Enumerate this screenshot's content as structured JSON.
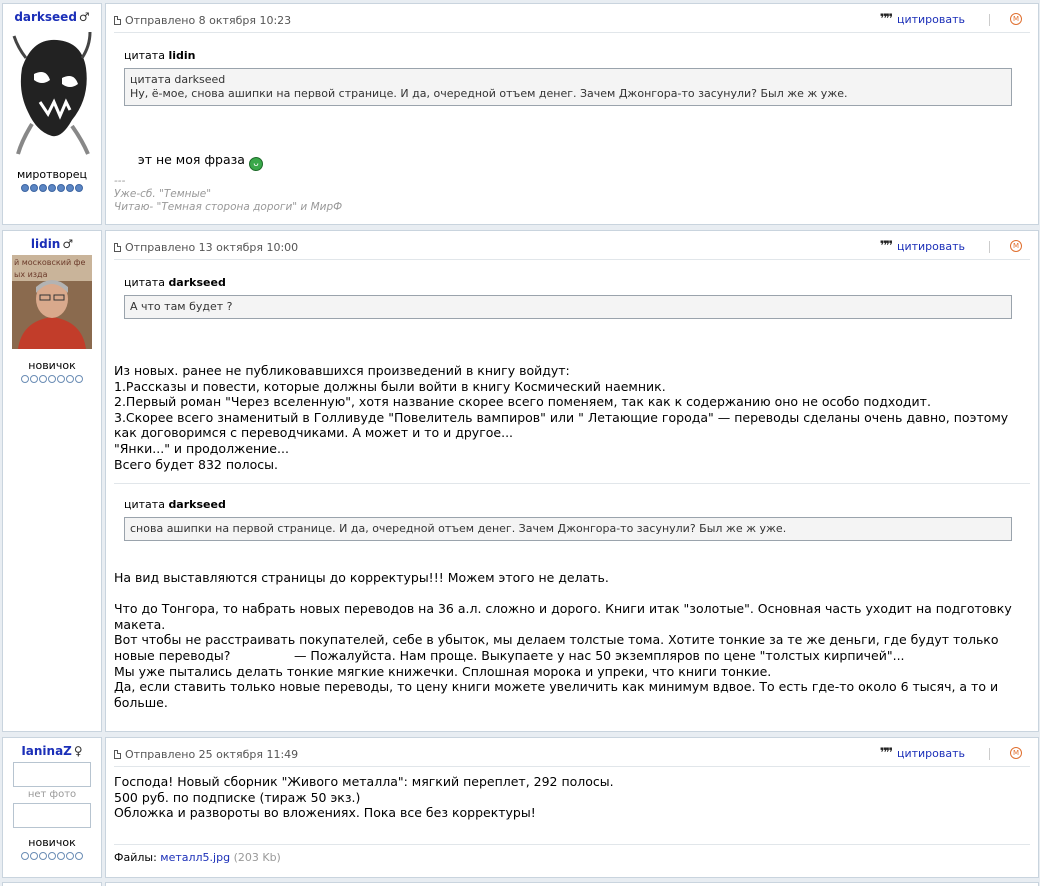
{
  "posts": [
    {
      "author": "darkseed",
      "gender_icon": "♂",
      "avatar": "dark-creature-avatar",
      "rank": "миротворец",
      "rank_level": 7,
      "posted": "Отправлено 8 октября 10:23",
      "quote_label": "цитировать",
      "outer_quote": {
        "prefix": "цитата",
        "author": "lidin"
      },
      "inner_quote": {
        "prefix": "цитата darkseed",
        "text": "Ну, ё-мое, снова ашипки на первой странице. И да, очередной отъем денег. Зачем Джонгора-то засунули? Был же ж уже."
      },
      "text": "эт не моя фраза",
      "smiley": "smiley-icon",
      "signature": "---\nУже-сб. \"Темные\"\nЧитаю- \"Темная сторона дороги\" и МирФ"
    },
    {
      "author": "lidin",
      "gender_icon": "♂",
      "avatar": "photo-avatar",
      "rank": "новичок",
      "rank_level": 0,
      "posted": "Отправлено 13 октября 10:00",
      "quote_label": "цитировать",
      "quote1": {
        "prefix": "цитата",
        "author": "darkseed",
        "text": "А что там будет ?"
      },
      "text1": "Из новых. ранее не публиковавшихся произведений в книгу войдут:\n1.Рассказы и повести, которые должны были войти в книгу Космический наемник.\n2.Первый роман \"Через вселенную\", хотя название скорее всего поменяем, так как к содержанию оно не особо подходит.\n3.Скорее всего знаменитый в Голливуде \"Повелитель вампиров\" или \" Летающие города\" — переводы сделаны очень давно, поэтому как договоримся с переводчиками. А может и то и другое...\n\"Янки...\" и продолжение...\nВсего будет 832 полосы.",
      "quote2": {
        "prefix": "цитата",
        "author": "darkseed",
        "text": "снова ашипки на первой странице. И да, очередной отъем денег. Зачем Джонгора-то засунули? Был же ж уже."
      },
      "text2": "На вид выставляются страницы до корректуры!!! Можем этого не делать.\n\nЧто до Тонгора, то набрать новых переводов на 36 а.л. сложно и дорого. Книги итак \"золотые\". Основная часть уходит на подготовку макета.\nВот чтобы не расстраивать покупателей, себе в убыток, мы делаем толстые тома. Хотите тонкие за те же деньги, где будут только новые переводы?                — Пожалуйста. Нам проще. Выкупаете у нас 50 экземпляров по цене \"толстых кирпичей\"...\nМы уже пытались делать тонкие мягкие книжечки. Сплошная морока и упреки, что книги тонкие.\nДа, если ставить только новые переводы, то цену книги можете увеличить как минимум вдвое. То есть где-то около 6 тысяч, а то и больше."
    },
    {
      "author": "IaninaZ",
      "gender_icon": "♀",
      "avatar_text": "нет фото",
      "rank": "новичок",
      "rank_level": 0,
      "posted": "Отправлено 25 октября 11:49",
      "quote_label": "цитировать",
      "text": "Господа! Новый сборник \"Живого металла\": мягкий переплет, 292 полосы.\n500 руб. по подписке (тираж 50 экз.)\nОбложка и развороты во вложениях. Пока все без корректуры!",
      "files_label": "Файлы:",
      "file_name": "металл5.jpg",
      "file_size": "(203 Kb)"
    }
  ],
  "colors": {
    "link": "#1b2fb8",
    "border": "#c9d4de",
    "mod": "#e07030"
  }
}
